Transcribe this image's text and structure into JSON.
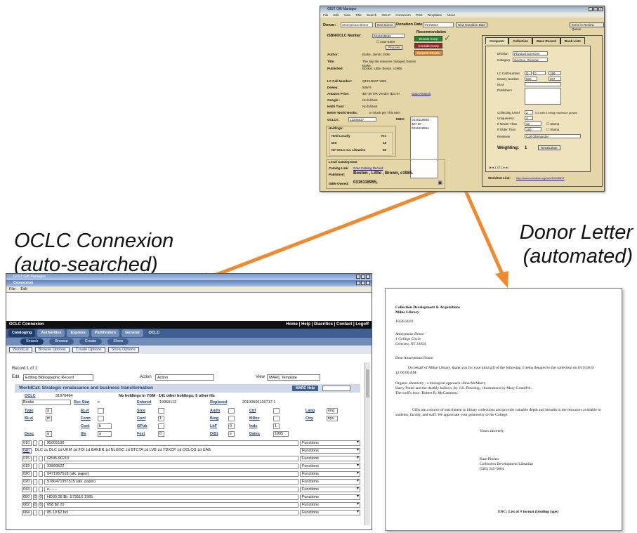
{
  "captions": {
    "left_line1": "OCLC Connexion",
    "left_line2": "(auto-searched)",
    "right_line1": "Donor Letter",
    "right_line2": "(automated)"
  },
  "colors": {
    "arrow": "#f08a2c",
    "gift_bg": "#e4d6a6",
    "donate_keep": "#1e8c2e",
    "consider_keep": "#9b2a2a",
    "request_review": "#f08a2c",
    "connexion_nav": "#3e5f8f"
  },
  "gift_manager": {
    "title": "GIST Gift Manager",
    "menu": [
      "File",
      "Edit",
      "View",
      "Title Search",
      "OCLC Connexion",
      "Print Templates",
      "About"
    ],
    "donor_label": "Donor:",
    "donor_value": "Anonymous Donor",
    "new_donor": "New Donor",
    "donation_date_label": "Donation Date:",
    "donation_date_value": "7/27/2010",
    "new_donation_date": "New Donation Date",
    "items_review": "Items in Review Queue",
    "isbn_label": "ISBN/OCLC Number",
    "isbn_value": "0316118955",
    "auto_enter": "Auto-Enter",
    "process": "Process",
    "recommendation": "Recommendation",
    "donate_keep": "Donate Keep",
    "consider_keep": "Consider Keep",
    "request_review": "Request Review",
    "left_fields": [
      {
        "label": "Author:",
        "value": "Burke, James 1936-"
      },
      {
        "label": "Title:",
        "value": "The day the universe changed /James Burke."
      },
      {
        "label": "Published:",
        "value": "Boston: Little, Brown, c1985."
      },
      {
        "label": "LC Call Number:",
        "value": "Q125.B937 1985"
      },
      {
        "label": "Dewey:",
        "value": "509/.9"
      },
      {
        "label": "Amazon Price:",
        "value": "$27.00 OR Vendor: $24.97"
      },
      {
        "label": "Google :",
        "value": "No full-text"
      },
      {
        "label": "Hathi Trust :",
        "value": "No full-text"
      },
      {
        "label": "Better World Books:",
        "value": "In-Stock per This Item"
      },
      {
        "label": "OCLC#:",
        "value": "12206817"
      }
    ],
    "amazon_link": "Goto Amazon",
    "isbn2_label": "ISBN:",
    "isbn2_values": [
      "0316118955 : $27.00",
      "0316118954"
    ],
    "holdings_title": "Holdings:",
    "holdings": [
      {
        "label": "Held Locally",
        "value": "Yes"
      },
      {
        "label": "IDS",
        "value": "18"
      },
      {
        "label": "NY OCLC ILL Libraries",
        "value": "59"
      }
    ],
    "local_catalog_title": "Local Catalog Data",
    "catalog_link_label": "Catalog Link:",
    "catalog_link_value": "Goto Catalog Record",
    "published_label": "Published:",
    "published_value": "Boston , Little , Brown,   c1985.",
    "isbn_owned_label": "ISBN Owned:",
    "isbn_owned_value": "0316118955,",
    "tabs": [
      "Computer",
      "Collection",
      "Mass Record",
      "Book Lists"
    ],
    "right_fields": [
      {
        "label": "Division",
        "value": "Physical Sciences"
      },
      {
        "label": "Category",
        "value": "Science, General"
      },
      {
        "label": "LC Call Number",
        "value": "Q"
      },
      {
        "label": "Dewey Number",
        "value": "500"
      },
      {
        "label": "NLM",
        "value": ""
      },
      {
        "label": "Publishers",
        "value": ""
      }
    ],
    "lc_range": [
      "0",
      "199"
    ],
    "dewey_range": [
      "500",
      "507"
    ],
    "collecting_level_label": "Collecting Level",
    "collecting_level_value": "3",
    "collecting_level_note": "0-5 with 5 being maximum growth",
    "uniqueness_label": "Uniqueness",
    "uniqueness_value": "4",
    "newer_label": "If Newer Than",
    "newer_value": "10",
    "older_label": "If Older Than",
    "older_value": "150",
    "stamp": "Stamp",
    "reviewer_label": "Reviewer",
    "reviewer_value": "Carl Oberlander",
    "weighting_label": "Weighting:",
    "weighting_value": "1",
    "recalculate": "Recalculate",
    "pager": "1  of 1",
    "worldcat_label": "WorldCat Link:",
    "worldcat_value": "http://www.worldcat.org/oclc/12206817"
  },
  "connexion": {
    "outer_title": "GIST Gift Manager",
    "inner_title": "Connexion",
    "menu": [
      "File",
      "Edit"
    ],
    "header_title": "OCLC Connexion",
    "header_links": "Home | Help | Diacritics | Contact | Logoff",
    "nav": [
      "Cataloging",
      "Authorities",
      "Express",
      "Pathfinders",
      "General",
      "OCLC"
    ],
    "sub": [
      "Search",
      "Browse",
      "Create",
      "Show"
    ],
    "options": [
      "WorldCat",
      "Browse Options",
      "Create Options",
      "Show Options"
    ],
    "record_label": "Record 1 of 1",
    "edit_label": "Edit",
    "edit_value": "Editing Bibliographic Record",
    "action_label": "Action",
    "action_value": "Action",
    "view_label": "View",
    "view_value": "MARC Template",
    "record_title": "WorldCat: Strategic renaissance and business transformation",
    "marc_help": "MARC Help",
    "oclc_label": "OCLC",
    "oclc_value": "31970484",
    "holdings_note": "No holdings in YGM - 141 other holdings; 5 other ills",
    "format": "Books",
    "fixed": [
      {
        "label": "Rec Stat",
        "value": "c"
      },
      {
        "label": "Entered",
        "value": "19950112"
      },
      {
        "label": "Replaced",
        "value": "20100506130717.1"
      },
      {
        "label": "Type",
        "value": "a"
      },
      {
        "label": "ELvl",
        "value": ""
      },
      {
        "label": "Srce",
        "value": ""
      },
      {
        "label": "Audn",
        "value": ""
      },
      {
        "label": "Ctrl",
        "value": ""
      },
      {
        "label": "Lang",
        "value": "eng"
      },
      {
        "label": "BLvl",
        "value": "m"
      },
      {
        "label": "Form",
        "value": ""
      },
      {
        "label": "Conf",
        "value": "1"
      },
      {
        "label": "Biog",
        "value": ""
      },
      {
        "label": "MRec",
        "value": ""
      },
      {
        "label": "Ctry",
        "value": "nyu"
      },
      {
        "label": "Cont",
        "value": "b"
      },
      {
        "label": "GPub",
        "value": ""
      },
      {
        "label": "LitF",
        "value": "0"
      },
      {
        "label": "Indx",
        "value": "1"
      },
      {
        "label": "Desc",
        "value": "a"
      },
      {
        "label": "Ills",
        "value": "a"
      },
      {
        "label": "Fest",
        "value": "0"
      },
      {
        "label": "DtSt",
        "value": "s"
      },
      {
        "label": "Dates",
        "value": "1995"
      }
    ],
    "rows": [
      {
        "tag": "010",
        "i1": "",
        "i2": "",
        "value": "95005190"
      },
      {
        "tag": "040",
        "i1": "",
        "i2": "",
        "value": "DLC ‡c DLC ‡d UKM ‡d FOI ‡d BAKER ‡d NLGGC ‡d BTCTA ‡d LVB ‡d YDXCP ‡d OCLCG ‡d UAB"
      },
      {
        "tag": "015",
        "i1": "",
        "i2": "",
        "value": "GB95-90210"
      },
      {
        "tag": "019",
        "i1": "",
        "i2": "",
        "value": "33899522"
      },
      {
        "tag": "020",
        "i1": "",
        "i2": "",
        "value": "0471957518 (alk. paper)"
      },
      {
        "tag": "020",
        "i1": "",
        "i2": "",
        "value": "9780471957515 (alk. paper)"
      },
      {
        "tag": "043",
        "i1": "",
        "i2": "",
        "value": "e------"
      },
      {
        "tag": "050",
        "i1": "0",
        "i2": "0",
        "value": "HD30.28 $b .S73516 1995"
      },
      {
        "tag": "082",
        "i1": "0",
        "i2": "0",
        "value": "658 $2 20"
      },
      {
        "tag": "084",
        "i1": "",
        "i2": "",
        "value": "85.10 $2 bcl"
      }
    ],
    "functions": "Functions"
  },
  "letter": {
    "heading1": "Collection Development & Acquisitions",
    "heading2": "Milne Library",
    "date": "10/26/2010",
    "addr1": "Anonymous Donor",
    "addr2": "1 College Circle",
    "addr3": "Geneseo, NY 14454",
    "salutation": "Dear  Anonymous Donor",
    "para1": "On behalf of Milne Library, thank you for your kind gift of the following 3 items donated to the collection on 8/19/2010 12:00:00 AM:",
    "items": [
      "Organic chemistry : a biological approach /John McMurry.",
      "Harry Potter and the deathly hallows /by J.K. Rowling ; illustrations by Mary GrandPré.",
      "The wolf's hour /Robert R. McCammon."
    ],
    "para2": "Gifts are a source of enrichment to library collections and provide valuable depth and breadth to the resources available to students, faculty, and staff. We appreciate your generosity to the College.",
    "closing": "Yours sincerely,",
    "sig1": "Kate Pitcher",
    "sig2": "Collection Development Librarian",
    "sig3": "(585) 245-5064",
    "enc": "ENC: List of # format (binding type)"
  }
}
